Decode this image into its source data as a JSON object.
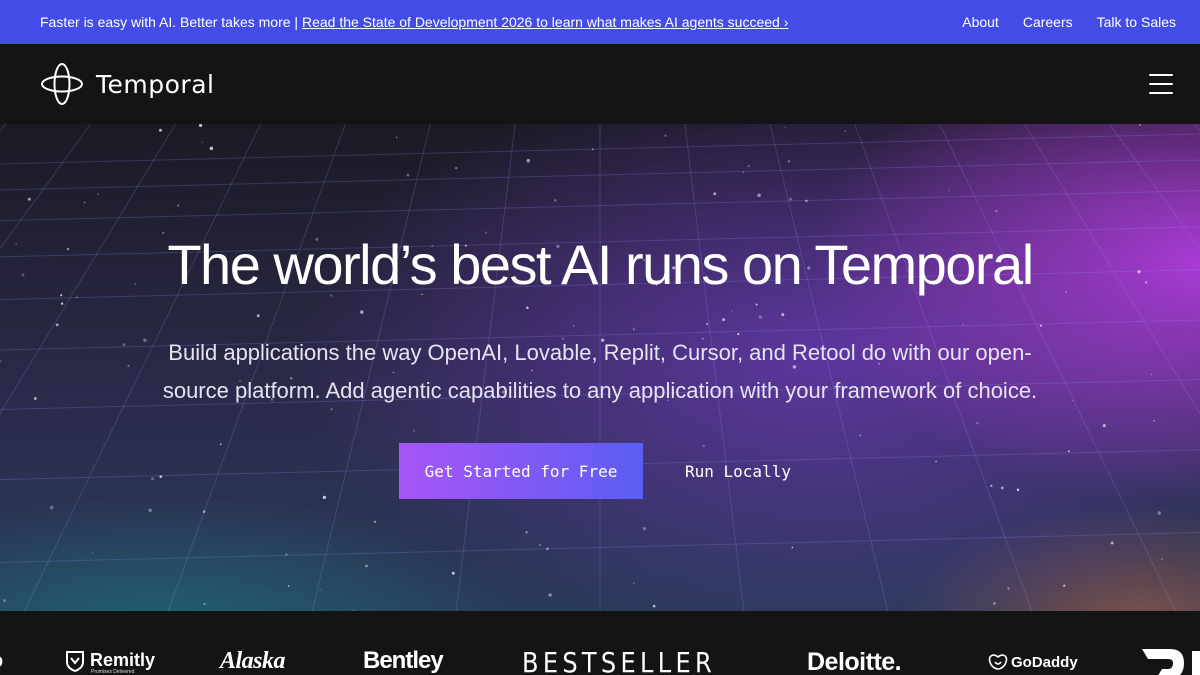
{
  "announcement": {
    "prefix": "Faster is easy with AI. Better takes more | ",
    "link_text": "Read the State of Development 2026 to learn what makes AI agents succeed ›",
    "links": [
      "About",
      "Careers",
      "Talk to Sales"
    ]
  },
  "nav": {
    "brand": "Temporal",
    "logo_icon": "temporal-logo-icon",
    "menu_icon": "hamburger-menu-icon"
  },
  "hero": {
    "title": "The world’s best AI runs on Temporal",
    "subtitle_line1": "Build applications the way OpenAI, Lovable, Replit, Cursor, and Retool do with our open-",
    "subtitle_line2": "source platform. Add agentic capabilities to any application with your framework of choice.",
    "primary_cta": "Get Started for Free",
    "secondary_cta": "Run Locally"
  },
  "customer_logos": [
    "Remitly",
    "Promises Delivered",
    "Alaska",
    "Bentley",
    "BESTSELLER",
    "Deloitte.",
    "GoDaddy"
  ],
  "colors": {
    "announcement_bg": "#444ce7",
    "nav_bg": "#141414",
    "cta_gradient_start": "#a855f7",
    "cta_gradient_end": "#5b5ef2"
  }
}
